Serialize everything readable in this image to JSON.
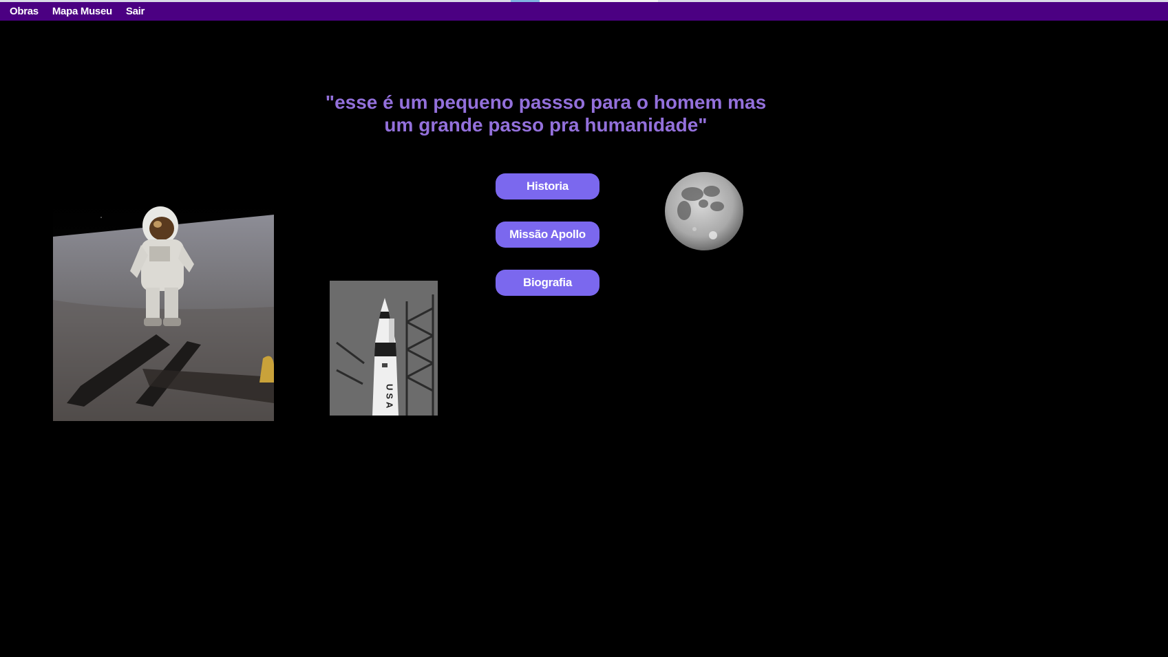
{
  "menu": {
    "items": [
      "Obras",
      "Mapa Museu",
      "Sair"
    ]
  },
  "quote": {
    "line1": "\"esse é um pequeno passso para o homem mas",
    "line2": "um grande passo pra humanidade\""
  },
  "buttons": {
    "historia": "Historia",
    "missao_apollo": "Missão Apollo",
    "biografia": "Biografia"
  },
  "images": {
    "astronaut": "astronaut-on-moon-photo",
    "rocket": "rocket-photo",
    "moon": "moon-photo",
    "rocket_lettering": "USA"
  },
  "colors": {
    "menubar": "#4b0082",
    "quote": "#9370db",
    "button": "#7b68ee",
    "background": "#000000"
  }
}
